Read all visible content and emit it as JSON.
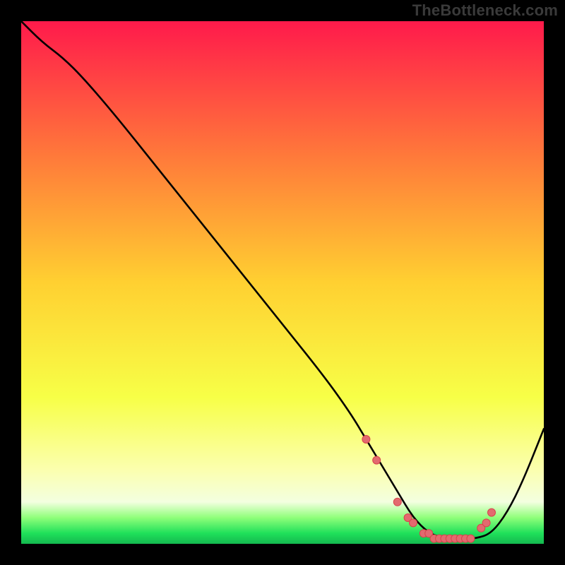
{
  "watermark": "TheBottleneck.com",
  "colors": {
    "frame_bg": "#000000",
    "gradient_top": "#ff1a4b",
    "gradient_mid_upper": "#ff7a3a",
    "gradient_mid": "#ffd031",
    "gradient_lower": "#f7ff47",
    "gradient_paleyellow": "#fbffb0",
    "gradient_green_light": "#8fff7a",
    "gradient_green": "#1fe05a",
    "gradient_green_deep": "#14b84f",
    "curve": "#000000",
    "marker_fill": "#e36a6f",
    "marker_stroke": "#d8434c"
  },
  "chart_data": {
    "type": "line",
    "title": "",
    "xlabel": "",
    "ylabel": "",
    "xlim": [
      0,
      100
    ],
    "ylim": [
      0,
      100
    ],
    "series": [
      {
        "name": "bottleneck-curve",
        "x": [
          0,
          4,
          8,
          12,
          18,
          26,
          34,
          42,
          50,
          58,
          63,
          66,
          69,
          72,
          75,
          78,
          81,
          84,
          87,
          90,
          93,
          96,
          100
        ],
        "y": [
          100,
          96,
          93,
          89,
          82,
          72,
          62,
          52,
          42,
          32,
          25,
          20,
          15,
          10,
          5,
          2,
          1,
          1,
          1,
          2,
          6,
          12,
          22
        ]
      }
    ],
    "markers": {
      "name": "highlight-points",
      "x": [
        66,
        68,
        72,
        74,
        75,
        77,
        78,
        79,
        80,
        81,
        82,
        83,
        84,
        85,
        86,
        88,
        89,
        90
      ],
      "y": [
        20,
        16,
        8,
        5,
        4,
        2,
        2,
        1,
        1,
        1,
        1,
        1,
        1,
        1,
        1,
        3,
        4,
        6
      ]
    }
  }
}
